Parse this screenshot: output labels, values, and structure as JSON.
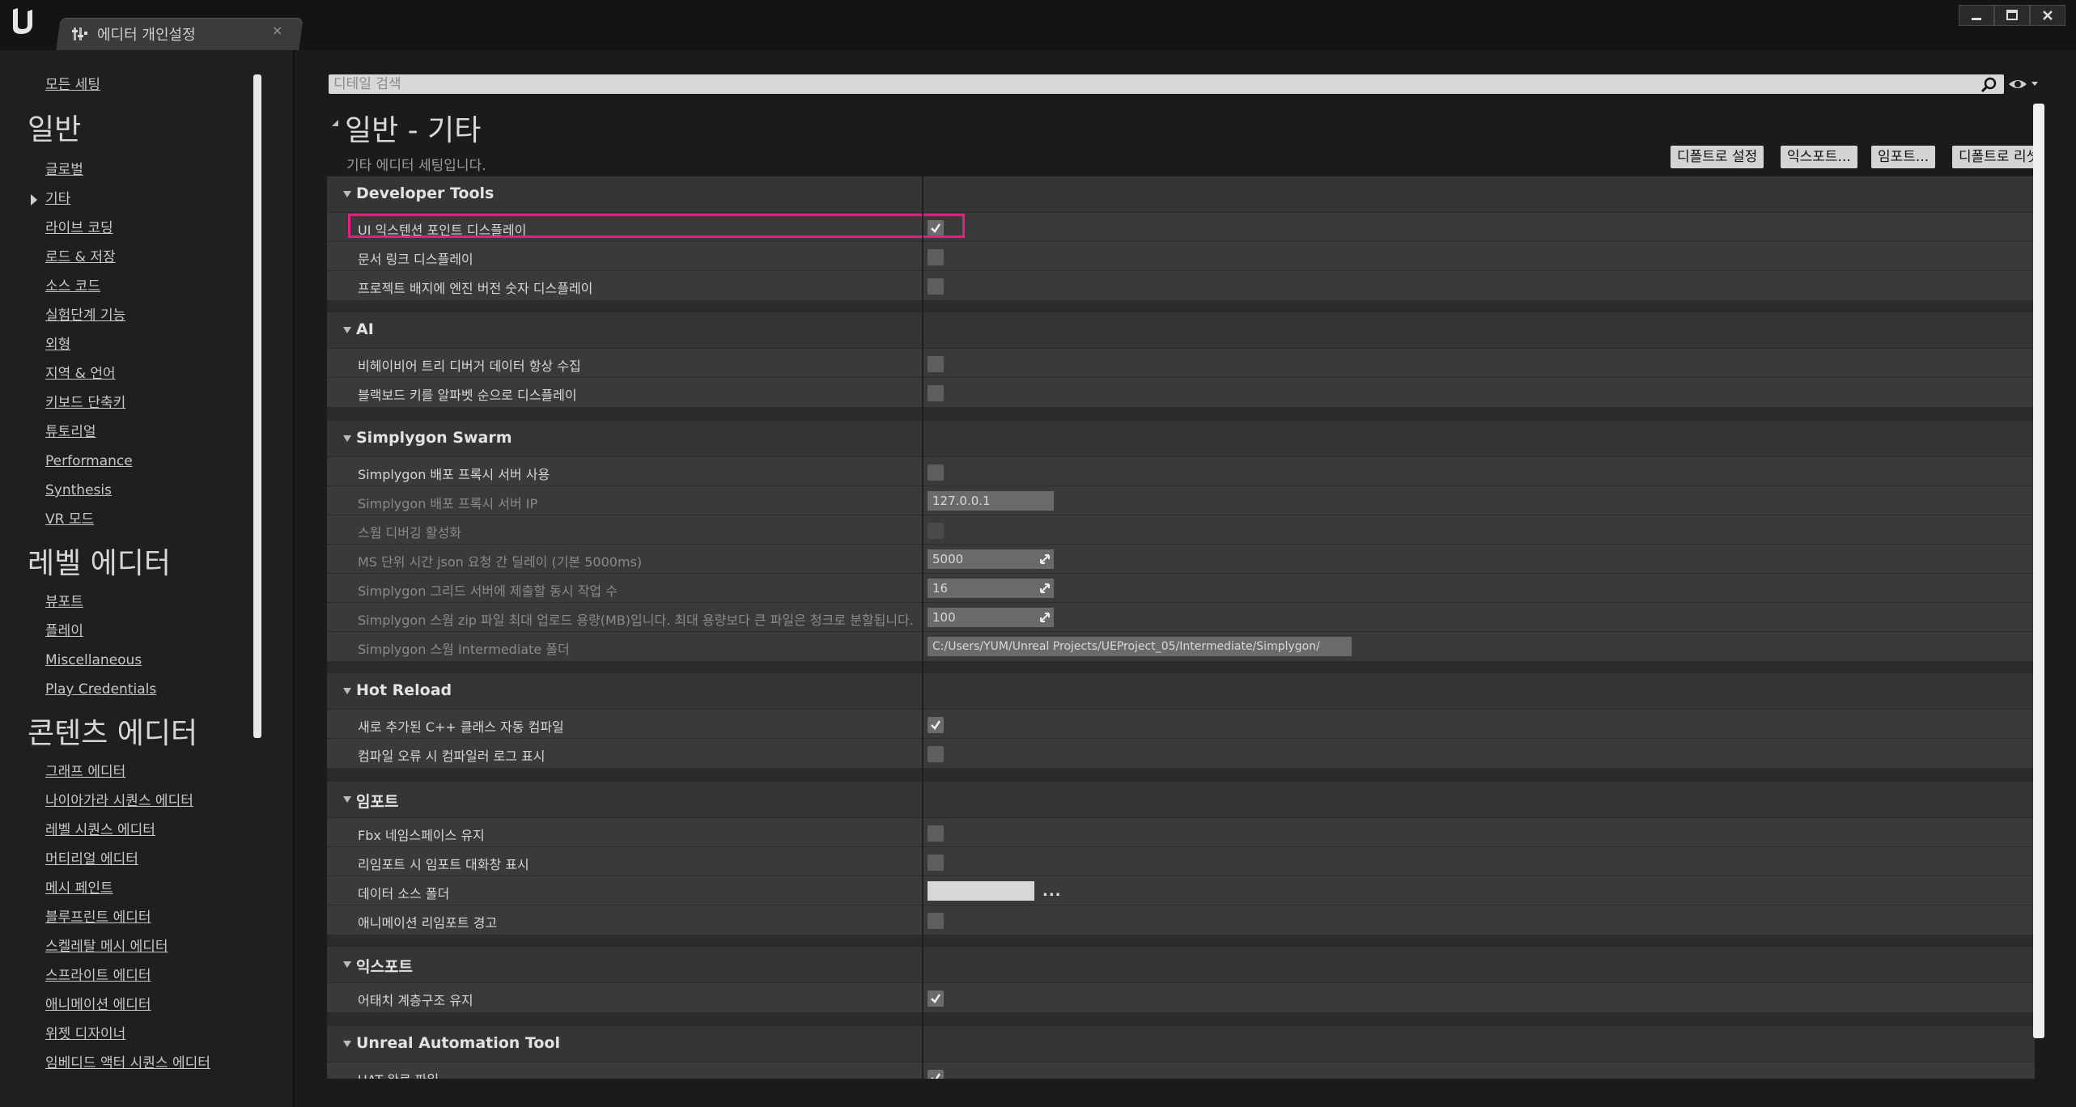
{
  "window": {
    "tab_title": "에디터 개인설정",
    "tab_close": "×"
  },
  "sidebar": {
    "top_item": "모든 세팅",
    "categories": [
      {
        "title": "일반",
        "items": [
          "글로벌",
          "기타",
          "라이브 코딩",
          "로드 & 저장",
          "소스 코드",
          "실험단계 기능",
          "외형",
          "지역 & 언어",
          "키보드 단축키",
          "튜토리얼",
          "Performance",
          "Synthesis",
          "VR 모드"
        ]
      },
      {
        "title": "레벨 에디터",
        "items": [
          "뷰포트",
          "플레이",
          "Miscellaneous",
          "Play Credentials"
        ]
      },
      {
        "title": "콘텐츠 에디터",
        "items": [
          "그래프 에디터",
          "나이아가라 시퀀스 에디터",
          "레벨 시퀀스 에디터",
          "머티리얼 에디터",
          "메시 페인트",
          "블루프린트 에디터",
          "스켈레탈 메시 에디터",
          "스프라이트 에디터",
          "애니메이션 에디터",
          "위젯 디자이너",
          "임베디드 액터 시퀀스 에디터"
        ]
      }
    ],
    "selected": "기타"
  },
  "search": {
    "placeholder": "디테일 검색"
  },
  "section": {
    "title": "일반 - 기타",
    "description": "기타 에디터 세팅입니다."
  },
  "buttons": {
    "reset_default": "디폴트로 설정",
    "export": "익스포트...",
    "import": "임포트...",
    "reset_to_default": "디폴트로 리셋"
  },
  "groups": [
    {
      "title": "Developer Tools",
      "rows": [
        {
          "label": "UI 익스텐션 포인트 디스플레이",
          "type": "checkbox",
          "checked": true
        },
        {
          "label": "문서 링크 디스플레이",
          "type": "checkbox",
          "checked": false
        },
        {
          "label": "프로젝트 배지에 엔진 버전 숫자 디스플레이",
          "type": "checkbox",
          "checked": false
        }
      ]
    },
    {
      "title": "AI",
      "rows": [
        {
          "label": "비헤이비어 트리 디버거 데이터 항상 수집",
          "type": "checkbox",
          "checked": false
        },
        {
          "label": "블랙보드 키를 알파벳 순으로 디스플레이",
          "type": "checkbox",
          "checked": false
        }
      ]
    },
    {
      "title": "Simplygon Swarm",
      "rows": [
        {
          "label": "Simplygon 배포 프록시 서버 사용",
          "type": "checkbox",
          "checked": false
        },
        {
          "label": "Simplygon 배포 프록시 서버 IP",
          "type": "text",
          "value": "127.0.0.1",
          "disabled": true
        },
        {
          "label": "스웜 디버깅 활성화",
          "type": "checkbox",
          "checked": false,
          "disabled": true
        },
        {
          "label": "MS 단위 시간 json 요청 간 딜레이 (기본 5000ms)",
          "type": "number",
          "value": "5000",
          "disabled": true
        },
        {
          "label": "Simplygon 그리드 서버에 제출할 동시 작업 수",
          "type": "number",
          "value": "16",
          "disabled": true
        },
        {
          "label": "Simplygon 스웜 zip 파일 최대 업로드 용량(MB)입니다. 최대 용량보다 큰 파일은 청크로 분할됩니다.",
          "type": "number",
          "value": "100",
          "disabled": true
        },
        {
          "label": "Simplygon 스웜 Intermediate 폴더",
          "type": "text",
          "value": "C:/Users/YUM/Unreal Projects/UEProject_05/Intermediate/Simplygon/",
          "disabled": true
        }
      ]
    },
    {
      "title": "Hot Reload",
      "rows": [
        {
          "label": "새로 추가된 C++ 클래스 자동 컴파일",
          "type": "checkbox",
          "checked": true
        },
        {
          "label": "컴파일 오류 시 컴파일러 로그 표시",
          "type": "checkbox",
          "checked": false
        }
      ]
    },
    {
      "title": "임포트",
      "rows": [
        {
          "label": "Fbx 네임스페이스 유지",
          "type": "checkbox",
          "checked": false
        },
        {
          "label": "리임포트 시 임포트 대화창 표시",
          "type": "checkbox",
          "checked": false
        },
        {
          "label": "데이터 소스 폴더",
          "type": "path",
          "value": "",
          "button": "..."
        },
        {
          "label": "애니메이션 리임포트 경고",
          "type": "checkbox",
          "checked": false
        }
      ]
    },
    {
      "title": "익스포트",
      "rows": [
        {
          "label": "어태치 계층구조 유지",
          "type": "checkbox",
          "checked": true
        }
      ]
    },
    {
      "title": "Unreal Automation Tool",
      "rows": [
        {
          "label": "UAT 완료 파일",
          "type": "checkbox",
          "checked": true
        }
      ]
    }
  ],
  "colors": {
    "highlight": "#e0227e",
    "panel_bg": "#2b2b2b",
    "row_bg": "#3a3a3a",
    "group_bg": "#353535"
  }
}
